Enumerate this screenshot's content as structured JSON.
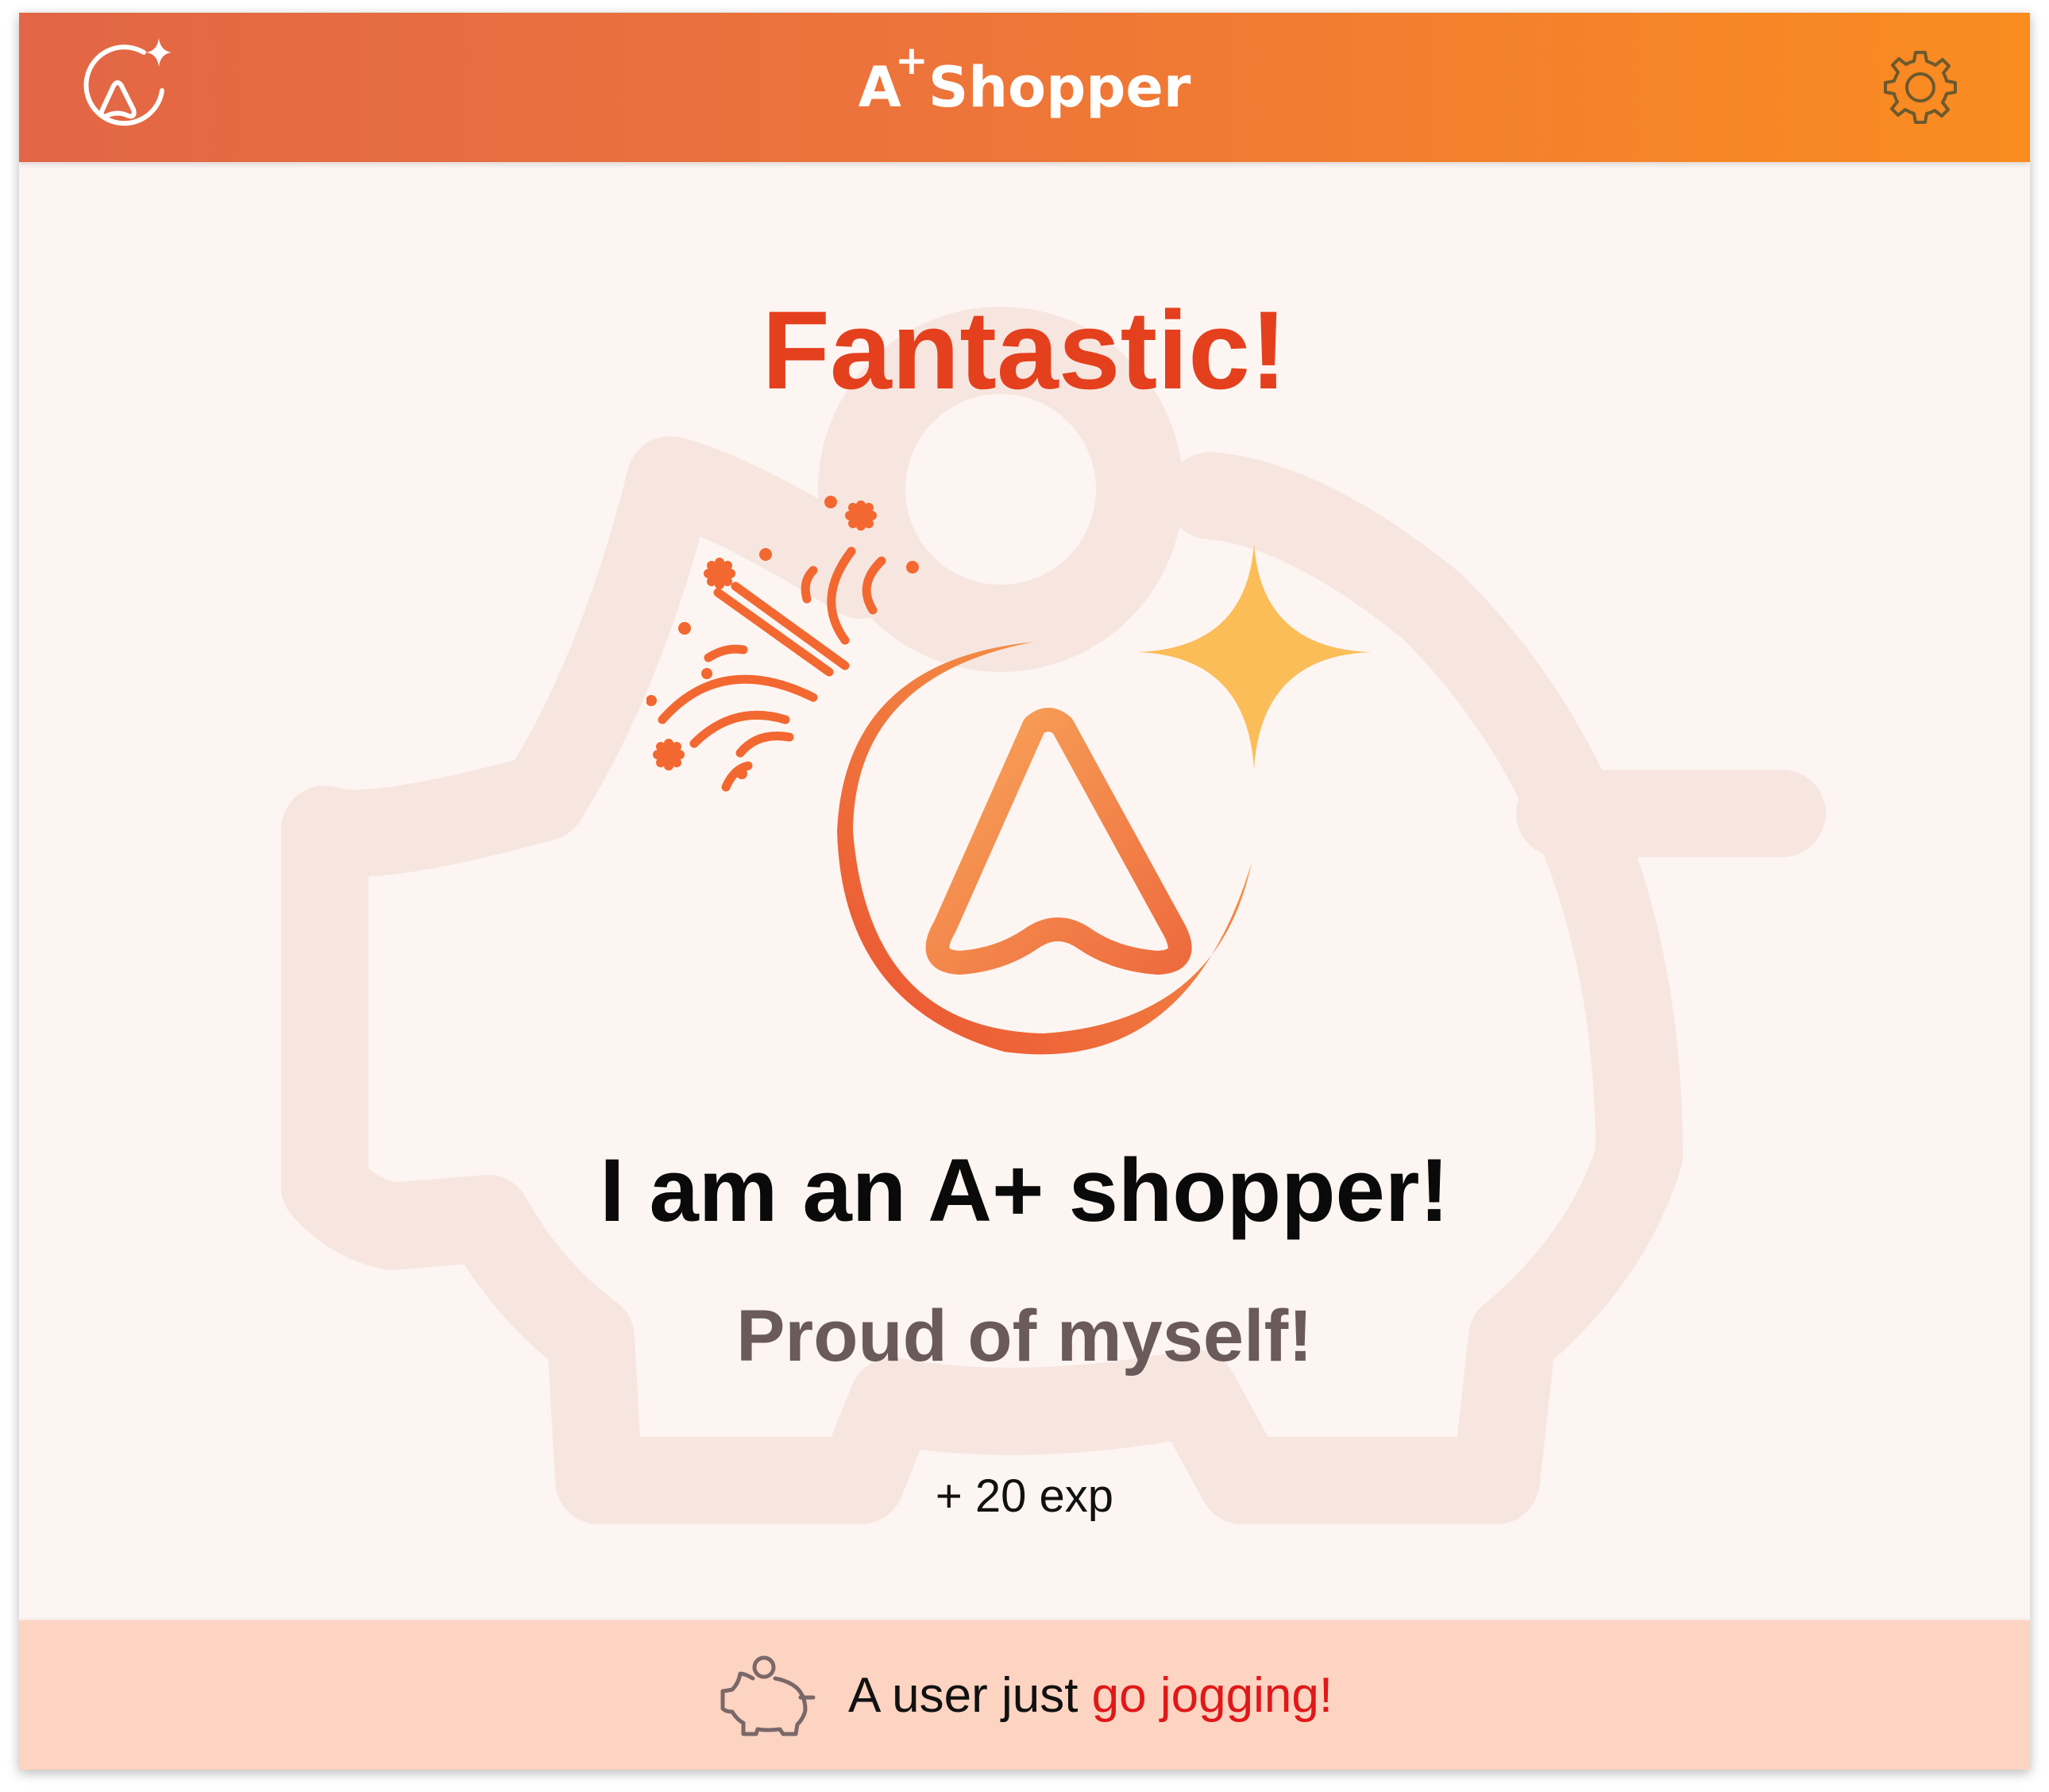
{
  "header": {
    "brand_letter": "A",
    "brand_sup": "+",
    "title_word": "Shopper",
    "logo_icon": "a-plus-logo-icon",
    "settings_icon": "gear-icon"
  },
  "main": {
    "headline": "Fantastic!",
    "badge_icon": "a-plus-badge-with-confetti-icon",
    "statement": "I am an A+ shopper!",
    "subline": "Proud of myself!",
    "reward": "+ 20 exp",
    "background_icon": "piggy-bank-watermark-icon"
  },
  "footer": {
    "icon": "piggy-bank-icon",
    "prefix": "A user just",
    "activity": "go jogging!"
  },
  "colors": {
    "header_start": "#e26646",
    "header_end": "#fb8c20",
    "headline": "#e4401e",
    "footer_bg": "#fdd3c1",
    "activity_text": "#e01818",
    "sparkle": "#fbbd57"
  }
}
